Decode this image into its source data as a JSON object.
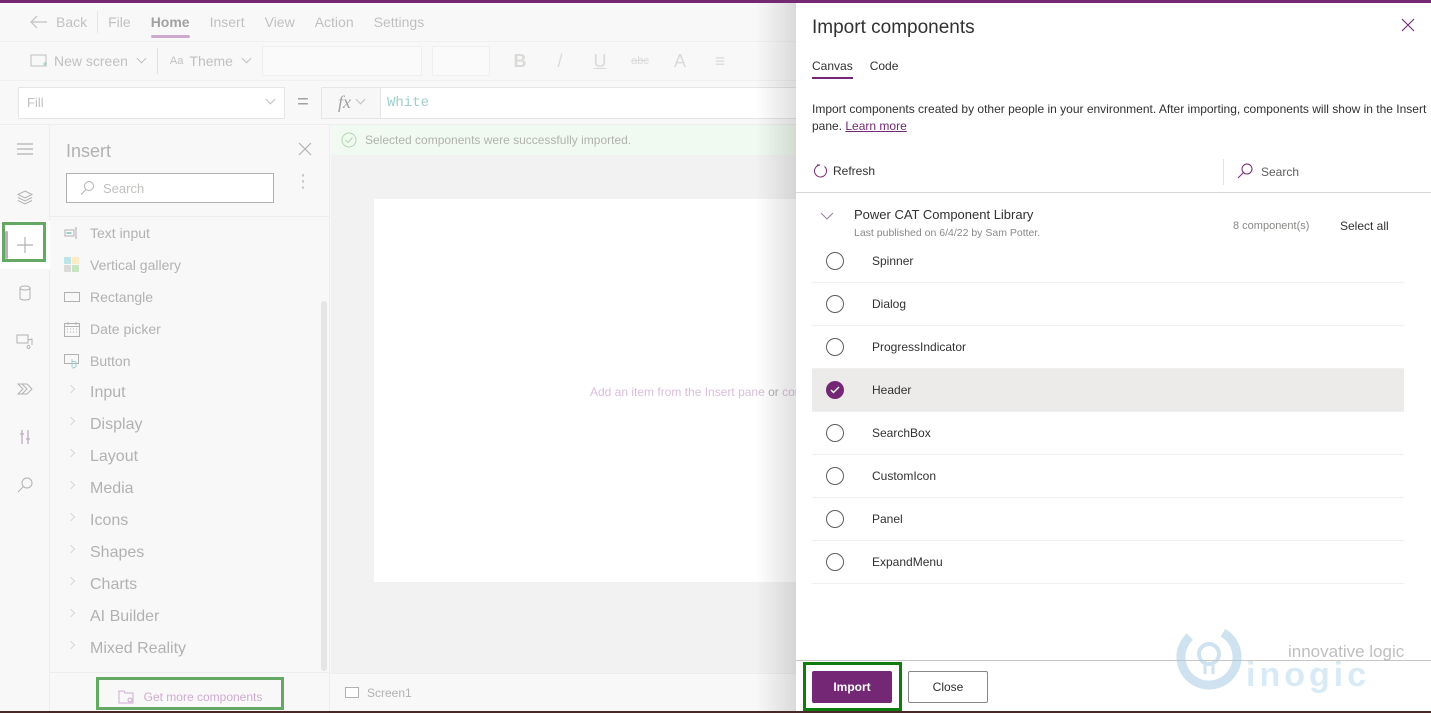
{
  "app": {
    "menu": {
      "back_label": "Back",
      "items": [
        {
          "label": "File",
          "active": false
        },
        {
          "label": "Home",
          "active": true
        },
        {
          "label": "Insert",
          "active": false
        },
        {
          "label": "View",
          "active": false
        },
        {
          "label": "Action",
          "active": false
        },
        {
          "label": "Settings",
          "active": false
        }
      ]
    },
    "toolbar": {
      "new_screen_label": "New screen",
      "theme_label": "Theme",
      "format_buttons": [
        "B",
        "/",
        "U",
        "abc",
        "A",
        "≡"
      ]
    },
    "formula_bar": {
      "property": "Fill",
      "equals": "=",
      "fx_label": "fx",
      "value": "White"
    },
    "rail": {
      "items": [
        "menu",
        "tree-view",
        "insert",
        "data",
        "media",
        "power-automate",
        "advanced-tools",
        "search"
      ],
      "active": "insert"
    },
    "insert_pane": {
      "title": "Insert",
      "search_placeholder": "Search",
      "items": [
        {
          "label": "Text input",
          "icon": "text-input-icon"
        },
        {
          "label": "Vertical gallery",
          "icon": "gallery-icon"
        },
        {
          "label": "Rectangle",
          "icon": "rectangle-icon"
        },
        {
          "label": "Date picker",
          "icon": "calendar-icon"
        },
        {
          "label": "Button",
          "icon": "button-icon"
        }
      ],
      "categories": [
        "Input",
        "Display",
        "Layout",
        "Media",
        "Icons",
        "Shapes",
        "Charts",
        "AI Builder",
        "Mixed Reality"
      ],
      "get_more_label": "Get more components"
    },
    "canvas": {
      "success_message": "Selected components were successfully imported.",
      "hint_part1": "Add an item from the Insert pane",
      "hint_or": "or",
      "hint_part2": "conne"
    },
    "screens": {
      "items": [
        "Screen1"
      ]
    }
  },
  "import_panel": {
    "title": "Import components",
    "tabs": [
      {
        "label": "Canvas",
        "active": true
      },
      {
        "label": "Code",
        "active": false
      }
    ],
    "description": "Import components created by other people in your environment. After importing, components will show in the Insert pane.",
    "learn_more": "Learn more",
    "refresh_label": "Refresh",
    "search_placeholder": "Search",
    "library": {
      "name": "Power CAT Component Library",
      "meta": "Last published on 6/4/22 by Sam Potter.",
      "count": "8 component(s)",
      "select_all": "Select all"
    },
    "components": [
      {
        "name": "Spinner",
        "selected": false
      },
      {
        "name": "Dialog",
        "selected": false
      },
      {
        "name": "ProgressIndicator",
        "selected": false
      },
      {
        "name": "Header",
        "selected": true
      },
      {
        "name": "SearchBox",
        "selected": false
      },
      {
        "name": "CustomIcon",
        "selected": false
      },
      {
        "name": "Panel",
        "selected": false
      },
      {
        "name": "ExpandMenu",
        "selected": false
      }
    ],
    "import_label": "Import",
    "close_label": "Close"
  },
  "watermark": {
    "tagline": "innovative logic",
    "brand": "inogic"
  },
  "colors": {
    "accent": "#742774",
    "highlight": "#107c10",
    "success_bg": "#e9f7e9"
  }
}
